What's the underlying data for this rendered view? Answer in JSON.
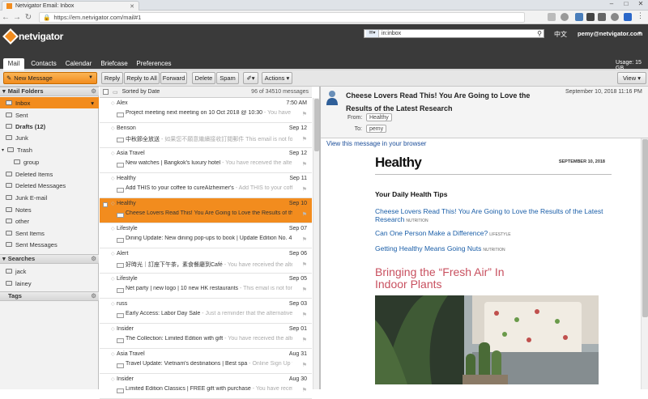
{
  "browser": {
    "tab_title": "Netvigator Email: Inbox",
    "url": "https://em.netvigator.com/mail#1"
  },
  "header": {
    "logo_text": "netvigator",
    "search_value": "in:inbox",
    "language": "中文",
    "user": "pemy@netvigator.com"
  },
  "nav": {
    "tabs": [
      "Mail",
      "Contacts",
      "Calendar",
      "Briefcase",
      "Preferences"
    ],
    "usage": "Usage: 15 GB"
  },
  "toolbar": {
    "new_message": "New Message",
    "reply": "Reply",
    "reply_all": "Reply to All",
    "forward": "Forward",
    "delete": "Delete",
    "spam": "Spam",
    "actions": "Actions",
    "view": "View"
  },
  "sidebar": {
    "mail_folders_title": "Mail Folders",
    "folders": [
      "Inbox",
      "Sent",
      "Drafts (12)",
      "Junk",
      "Trash",
      "group",
      "Deleted Items",
      "Deleted Messages",
      "Junk E-mail",
      "Notes",
      "other",
      "Sent Items",
      "Sent Messages"
    ],
    "searches_title": "Searches",
    "searches": [
      "jack",
      "lainey"
    ],
    "tags_title": "Tags"
  },
  "list": {
    "sort_label": "Sorted by Date",
    "count": "96 of 34510 messages",
    "messages": [
      {
        "from": "Alex",
        "date": "7:50 AM",
        "subject": "Project meeting next meeting on 10 Oct 2018 @ 10:30",
        "preview": " - You have receiv"
      },
      {
        "from": "Benson",
        "date": "Sep 12",
        "subject": "中秋節全放送",
        "preview": " - 如果您不願意繼續接收訂閱郵件 This email is not formatt"
      },
      {
        "from": "Asia Travel",
        "date": "Sep 12",
        "subject": "New watches | Bangkok's luxury hotel",
        "preview": " - You have received the alternative"
      },
      {
        "from": "Healthy",
        "date": "Sep 11",
        "subject": "Add THIS to your coffee to cureAlzheimer's",
        "preview": " - Add THIS to your coffee to c"
      },
      {
        "from": "Healthy",
        "date": "Sep 10",
        "subject": "Cheese Lovers Read This! You Are Going to Love the Results of the Latest",
        "preview": ""
      },
      {
        "from": "Lifestyle",
        "date": "Sep 07",
        "subject": "Dining Update:  New dining pop-ups to book | Update Edition No. 4 | Kyt",
        "preview": ""
      },
      {
        "from": "Alert",
        "date": "Sep 06",
        "subject": "好時光｜訂座下午茶，素食餐廳到Café",
        "preview": " - You have received the alternative"
      },
      {
        "from": "Lifestyle",
        "date": "Sep 05",
        "subject": "Net party | new logo | 10 new HK restaurants",
        "preview": " - This email is not formatted"
      },
      {
        "from": "russ",
        "date": "Sep 03",
        "subject": "Early Access: Labor Day Sale",
        "preview": " - Just a reminder that the alternative outdoor"
      },
      {
        "from": "Insider",
        "date": "Sep 01",
        "subject": "The Collection: Limited Edition with gift",
        "preview": " - You have received the alternative"
      },
      {
        "from": "Asia Travel",
        "date": "Aug 31",
        "subject": "Travel Update: Vietnam's destinations | Best spa",
        "preview": " - Online Sign Up for view"
      },
      {
        "from": "Insider",
        "date": "Aug 30",
        "subject": "Limited Edition Classics | FREE gift with purchase",
        "preview": " - You have receiv"
      }
    ]
  },
  "reading": {
    "subject": "Cheese Lovers Read This! You Are Going to Love the Results of the Latest Research",
    "date": "September 10, 2018 11:16 PM",
    "from_label": "From:",
    "from": "Healthy",
    "to_label": "To:",
    "to": "pemy",
    "view_link": "View this message in your browser",
    "newsletter": {
      "title": "Healthy",
      "date": "SEPTEMBER 10, 2018",
      "tips_heading": "Your Daily Health Tips",
      "links": [
        {
          "text": "Cheese Lovers Read This! You Are Going to Love the Results of the Latest Research",
          "tag": "NUTRITION"
        },
        {
          "text": "Can One Person Make a Difference?",
          "tag": "LIFESTYLE"
        },
        {
          "text": "Getting Healthy Means Going Nuts",
          "tag": "NUTRITION"
        }
      ],
      "feature": "Bringing the “Fresh Air” In Indoor Plants"
    }
  },
  "colors": {
    "accent": "#f28c1e",
    "header": "#3a3a3a",
    "link": "#1a5ea8",
    "feature": "#c8505f"
  }
}
